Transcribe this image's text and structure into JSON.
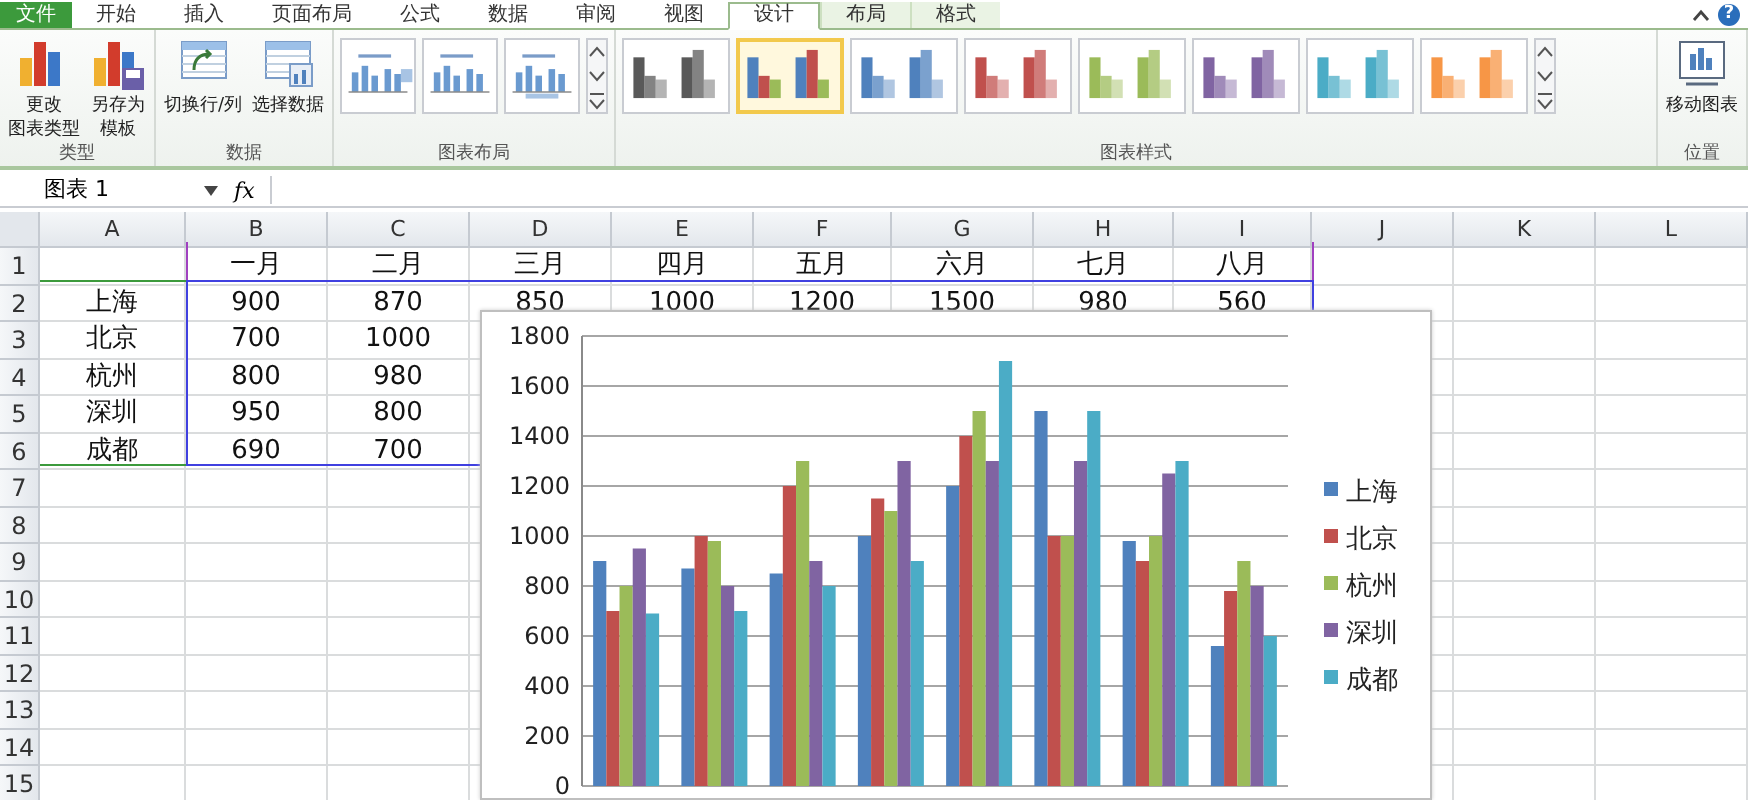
{
  "ribbon_tabs": [
    {
      "label": "文件",
      "kind": "file",
      "selected": false
    },
    {
      "label": "开始",
      "kind": "app",
      "selected": false
    },
    {
      "label": "插入",
      "kind": "app",
      "selected": false
    },
    {
      "label": "页面布局",
      "kind": "app",
      "selected": false
    },
    {
      "label": "公式",
      "kind": "app",
      "selected": false
    },
    {
      "label": "数据",
      "kind": "app",
      "selected": false
    },
    {
      "label": "审阅",
      "kind": "app",
      "selected": false
    },
    {
      "label": "视图",
      "kind": "app",
      "selected": false
    },
    {
      "label": "设计",
      "kind": "chart_tool",
      "selected": true
    },
    {
      "label": "布局",
      "kind": "chart_tool",
      "selected": false
    },
    {
      "label": "格式",
      "kind": "chart_tool",
      "selected": false
    }
  ],
  "help": "?",
  "ribbon_groups": [
    {
      "title": "类型",
      "kind": "buttons",
      "buttons": [
        {
          "kind": "change_type",
          "lines": [
            "更改",
            "图表类型"
          ]
        },
        {
          "kind": "save_template",
          "lines": [
            "另存为",
            "模板"
          ]
        }
      ]
    },
    {
      "title": "数据",
      "kind": "buttons",
      "buttons": [
        {
          "kind": "switch",
          "lines": [
            "切换行/列"
          ]
        },
        {
          "kind": "select_data",
          "lines": [
            "选择数据"
          ]
        }
      ]
    },
    {
      "title": "图表布局",
      "kind": "layouts",
      "items": [
        {
          "selected": false
        },
        {
          "selected": false
        },
        {
          "selected": false
        }
      ]
    },
    {
      "title": "图表样式",
      "kind": "styles",
      "items": [
        {
          "kind": "mono",
          "color": "#595959",
          "selected": false
        },
        {
          "kind": "mixed",
          "color": "#4f81bd",
          "selected": true
        },
        {
          "kind": "mono",
          "color": "#4f81bd",
          "selected": false
        },
        {
          "kind": "mono",
          "color": "#c0504d",
          "selected": false
        },
        {
          "kind": "mono",
          "color": "#9bbb59",
          "selected": false
        },
        {
          "kind": "mono",
          "color": "#8064a2",
          "selected": false
        },
        {
          "kind": "mono",
          "color": "#4bacc6",
          "selected": false
        },
        {
          "kind": "mono",
          "color": "#f79646",
          "selected": false
        }
      ]
    },
    {
      "title": "位置",
      "kind": "buttons",
      "buttons": [
        {
          "kind": "move",
          "lines": [
            "移动图表"
          ]
        }
      ]
    }
  ],
  "formula_bar": {
    "name_box": "图表 1",
    "function_button": "fx"
  },
  "sheet": {
    "columns": [
      "A",
      "B",
      "C",
      "D",
      "E",
      "F",
      "G",
      "H",
      "I",
      "J",
      "K",
      "L"
    ],
    "rows": [
      {
        "number": "1",
        "cells": [
          null,
          "一月",
          "二月",
          "三月",
          "四月",
          "五月",
          "六月",
          "七月",
          "八月"
        ]
      },
      {
        "number": "2",
        "cells": [
          "上海",
          "900",
          "870",
          "850",
          "1000",
          "1200",
          "1500",
          "980",
          "560"
        ]
      },
      {
        "number": "3",
        "cells": [
          "北京",
          "700",
          "1000"
        ]
      },
      {
        "number": "4",
        "cells": [
          "杭州",
          "800",
          "980"
        ]
      },
      {
        "number": "5",
        "cells": [
          "深圳",
          "950",
          "800"
        ]
      },
      {
        "number": "6",
        "cells": [
          "成都",
          "690",
          "700"
        ]
      },
      {
        "number": "7"
      },
      {
        "number": "8"
      },
      {
        "number": "9"
      },
      {
        "number": "10"
      },
      {
        "number": "11"
      },
      {
        "number": "12"
      },
      {
        "number": "13"
      },
      {
        "number": "14"
      },
      {
        "number": "15"
      }
    ]
  },
  "chart": {
    "chart_data": {
      "type": "bar",
      "grid": true,
      "legend": true,
      "ylim": [
        0,
        1800
      ],
      "yticks": [
        {
          "value": 0,
          "label": "0"
        },
        {
          "value": 200,
          "label": "200"
        },
        {
          "value": 400,
          "label": "400"
        },
        {
          "value": 600,
          "label": "600"
        },
        {
          "value": 800,
          "label": "800"
        },
        {
          "value": 1000,
          "label": "1000"
        },
        {
          "value": 1200,
          "label": "1200"
        },
        {
          "value": 1400,
          "label": "1400"
        },
        {
          "value": 1600,
          "label": "1600"
        },
        {
          "value": 1800,
          "label": "1800"
        }
      ],
      "series": [
        {
          "name": "上海",
          "color": "#4f81bd",
          "values": [
            900,
            870,
            850,
            1000,
            1200,
            1500,
            980,
            560
          ]
        },
        {
          "name": "北京",
          "color": "#c0504d",
          "values": [
            700,
            1000,
            1200,
            1150,
            1400,
            1000,
            900,
            780
          ]
        },
        {
          "name": "杭州",
          "color": "#9bbb59",
          "values": [
            800,
            980,
            1300,
            1100,
            1500,
            1000,
            1000,
            900
          ]
        },
        {
          "name": "深圳",
          "color": "#8064a2",
          "values": [
            950,
            800,
            900,
            1300,
            1300,
            1300,
            1250,
            800
          ]
        },
        {
          "name": "成都",
          "color": "#4bacc6",
          "values": [
            690,
            700,
            800,
            900,
            1700,
            1500,
            1300,
            600
          ]
        }
      ]
    }
  }
}
